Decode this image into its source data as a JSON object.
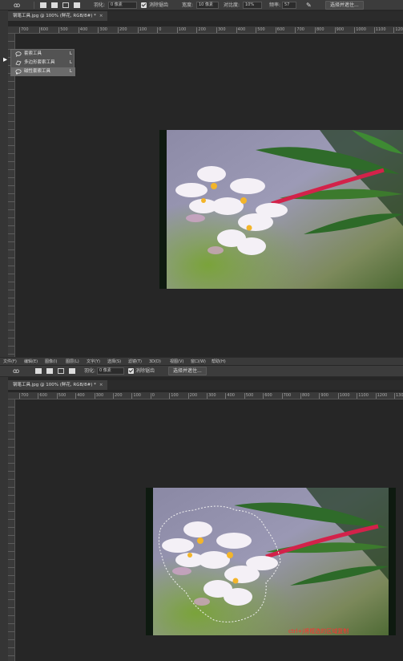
{
  "top_panel": {
    "options": {
      "feather_label": "羽化:",
      "feather_value": "0 像素",
      "antialias_label": "消除锯齿",
      "width_label": "宽度:",
      "width_value": "10 像素",
      "contrast_label": "对比度:",
      "contrast_value": "10%",
      "frequency_label": "频率:",
      "frequency_value": "57",
      "select_mask_button": "选择并遮住..."
    },
    "tab": {
      "label": "钢笔工具.jpg @ 100% (鲜花, RGB/8#) *",
      "close": "×"
    },
    "ruler_ticks": [
      "700",
      "600",
      "500",
      "400",
      "300",
      "200",
      "100",
      "0",
      "100",
      "200",
      "300",
      "400",
      "500",
      "600",
      "700",
      "800",
      "900",
      "1000",
      "1100",
      "120"
    ],
    "lasso_flyout": [
      {
        "name": "套索工具",
        "key": "L"
      },
      {
        "name": "多边形套索工具",
        "key": "L"
      },
      {
        "name": "磁性套索工具",
        "key": "L"
      }
    ]
  },
  "menubar": [
    "文件(F)",
    "编辑(E)",
    "图像(I)",
    "图层(L)",
    "文字(Y)",
    "选择(S)",
    "滤镜(T)",
    "3D(D)",
    "视图(V)",
    "窗口(W)",
    "帮助(H)"
  ],
  "bottom_panel": {
    "options": {
      "feather_label": "羽化:",
      "feather_value": "0 像素",
      "antialias_label": "消除锯齿",
      "select_mask_button": "选择并遮住..."
    },
    "tab": {
      "label": "钢笔工具.jpg @ 100% (鲜花, RGB/8#) *",
      "close": "×"
    },
    "ruler_ticks": [
      "700",
      "600",
      "500",
      "400",
      "300",
      "200",
      "100",
      "0",
      "100",
      "200",
      "300",
      "400",
      "500",
      "600",
      "700",
      "800",
      "900",
      "1000",
      "1100",
      "1200",
      "1300"
    ],
    "caption": "ctrl+j将框选的区域复制"
  },
  "colors": {
    "accent_caption": "#ff3030",
    "app_bg": "#262626",
    "panel": "#3c3c3c"
  }
}
